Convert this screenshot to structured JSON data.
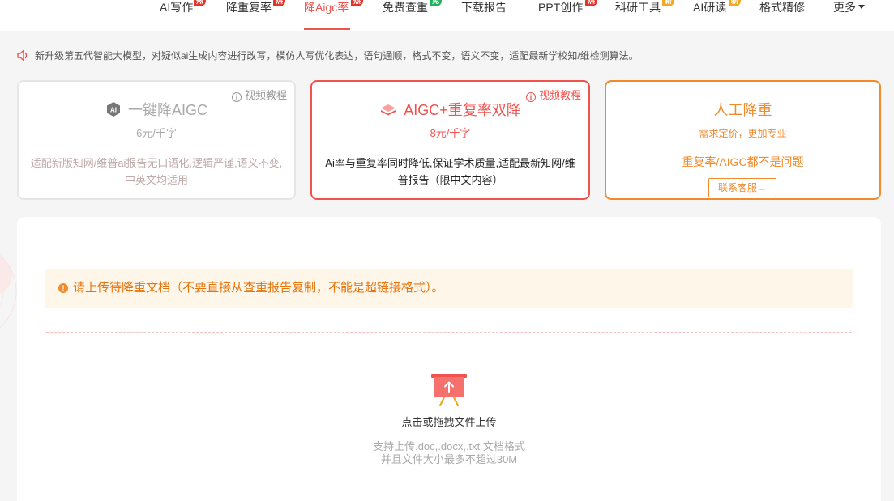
{
  "nav": {
    "items": [
      {
        "label": "AI写作",
        "badge": "热"
      },
      {
        "label": "降重复率",
        "badge": "热"
      },
      {
        "label": "降Aigc率",
        "badge": "热"
      },
      {
        "label": "免费查重",
        "badge": "免"
      },
      {
        "label": "下载报告",
        "badge": ""
      },
      {
        "label": "PPT创作",
        "badge": "热"
      },
      {
        "label": "科研工具",
        "badge": "新"
      },
      {
        "label": "AI研读",
        "badge": "新"
      },
      {
        "label": "格式精修",
        "badge": ""
      },
      {
        "label": "更多",
        "badge": ""
      }
    ],
    "active": "降Aigc率"
  },
  "notice": {
    "text": "新升级第五代智能大模型，对疑似ai生成内容进行改写，模仿人写优化表达，语句通顺，格式不变，语义不变，适配最新学校知/维检测算法。"
  },
  "cards": [
    {
      "video_label": "视频教程",
      "title": "一键降AIGC",
      "price": "6元/千字",
      "description": "适配新版知网/维普ai报告无口语化,逻辑严谨,语义不变,中英文均适用"
    },
    {
      "video_label": "视频教程",
      "title": "AIGC+重复率双降",
      "price": "8元/千字",
      "description": "Ai率与重复率同时降低,保证学术质量,适配最新知网/维普报告（限中文内容）"
    },
    {
      "title": "人工降重",
      "price": "需求定价，更加专业",
      "description": "重复率/AIGC都不是问题",
      "button_label": "联系客服→"
    }
  ],
  "main": {
    "warning": "请上传待降重文档（不要直接从查重报告复制，不能是超链接格式）。",
    "upload": {
      "title": "点击或拖拽文件上传",
      "hint_line1": "支持上传.doc,.docx,.txt 文档格式",
      "hint_line2": "并且文件大小最多不超过30M"
    }
  },
  "colors": {
    "accent": "#f0524e",
    "orange": "#f08a2b",
    "badge_hot": "#e8332d",
    "badge_free": "#20b15a",
    "badge_new": "#f5a623"
  },
  "icons": {
    "notice": "speaker-icon",
    "video": "info-circle-icon",
    "card1": "ai-chip-icon",
    "card2": "layers-icon",
    "warning": "info-filled-icon",
    "upload": "upload-board-icon"
  }
}
